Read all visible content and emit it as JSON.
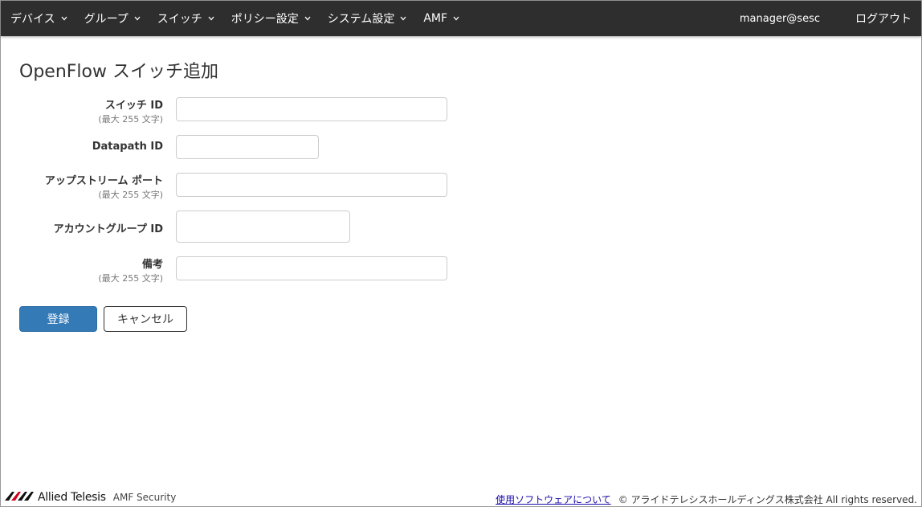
{
  "nav": {
    "items": [
      {
        "label": "デバイス"
      },
      {
        "label": "グループ"
      },
      {
        "label": "スイッチ"
      },
      {
        "label": "ポリシー設定"
      },
      {
        "label": "システム設定"
      },
      {
        "label": "AMF"
      }
    ],
    "user": "manager@sesc",
    "logout": "ログアウト"
  },
  "page": {
    "title": "OpenFlow スイッチ追加"
  },
  "form": {
    "switch_id": {
      "label": "スイッチ ID",
      "hint": "(最大 255 文字)",
      "value": ""
    },
    "datapath_id": {
      "label": "Datapath ID",
      "value": ""
    },
    "upstream_port": {
      "label": "アップストリーム ポート",
      "hint": "(最大 255 文字)",
      "value": ""
    },
    "account_group_id": {
      "label": "アカウントグループ ID",
      "value": ""
    },
    "remarks": {
      "label": "備考",
      "hint": "(最大 255 文字)",
      "value": ""
    }
  },
  "buttons": {
    "register": "登録",
    "cancel": "キャンセル"
  },
  "footer": {
    "brand": "Allied Telesis",
    "product": "AMF Security",
    "link": "使用ソフトウェアについて",
    "copyright": "© アライドテレシスホールディングス株式会社 All rights reserved."
  },
  "colors": {
    "navbar_bg": "#2e2e2e",
    "primary": "#337ab7",
    "link": "#1a0dab",
    "logo_red": "#d0021b"
  },
  "icons": {
    "nav_caret": "chevron-down-icon",
    "logo": "allied-telesis-logo-icon"
  }
}
